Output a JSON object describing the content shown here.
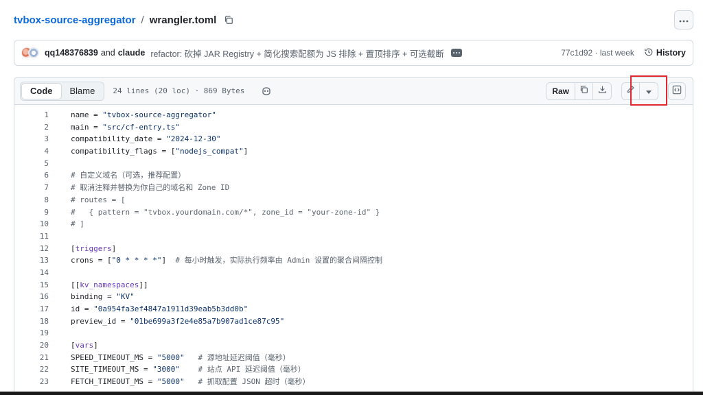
{
  "breadcrumb": {
    "repo": "tvbox-source-aggregator",
    "separator": "/",
    "file": "wrangler.toml"
  },
  "commit": {
    "user1": "qq148376839",
    "and": "and",
    "user2": "claude",
    "message": "refactor: 砍掉 JAR Registry + 简化搜索配额为 JS 排除 + 置顶排序 + 可选截断",
    "hash_time": "77c1d92 · last week",
    "history_label": "History"
  },
  "file_header": {
    "tab_code": "Code",
    "tab_blame": "Blame",
    "info": "24 lines (20 loc) · 869 Bytes",
    "raw_label": "Raw"
  },
  "icons": [
    "copy-icon",
    "kebab-icon",
    "copilot-icon",
    "download-icon",
    "pencil-icon",
    "triangle-down-icon",
    "code-square-icon",
    "history-icon"
  ],
  "colors": {
    "link": "#0969da",
    "highlight": "#e0282e",
    "string": "#0a3069",
    "section": "#6639ba"
  },
  "code_lines": [
    {
      "n": "1",
      "t": [
        [
          "k",
          "name = "
        ],
        [
          "s",
          "\"tvbox-source-aggregator\""
        ]
      ]
    },
    {
      "n": "2",
      "t": [
        [
          "k",
          "main = "
        ],
        [
          "s",
          "\"src/cf-entry.ts\""
        ]
      ]
    },
    {
      "n": "3",
      "t": [
        [
          "k",
          "compatibility_date = "
        ],
        [
          "s",
          "\"2024-12-30\""
        ]
      ]
    },
    {
      "n": "4",
      "t": [
        [
          "k",
          "compatibility_flags = ["
        ],
        [
          "s",
          "\"nodejs_compat\""
        ],
        [
          "k",
          "]"
        ]
      ]
    },
    {
      "n": "5",
      "t": []
    },
    {
      "n": "6",
      "t": [
        [
          "c",
          "# 自定义域名（可选，推荐配置）"
        ]
      ]
    },
    {
      "n": "7",
      "t": [
        [
          "c",
          "# 取消注释并替换为你自己的域名和 Zone ID"
        ]
      ]
    },
    {
      "n": "8",
      "t": [
        [
          "c",
          "# routes = ["
        ]
      ]
    },
    {
      "n": "9",
      "t": [
        [
          "c",
          "#   { pattern = \"tvbox.yourdomain.com/*\", zone_id = \"your-zone-id\" }"
        ]
      ]
    },
    {
      "n": "10",
      "t": [
        [
          "c",
          "# ]"
        ]
      ]
    },
    {
      "n": "11",
      "t": []
    },
    {
      "n": "12",
      "t": [
        [
          "k",
          "["
        ],
        [
          "x",
          "triggers"
        ],
        [
          "k",
          "]"
        ]
      ]
    },
    {
      "n": "13",
      "t": [
        [
          "k",
          "crons = ["
        ],
        [
          "s",
          "\"0 * * * *\""
        ],
        [
          "k",
          "]  "
        ],
        [
          "c",
          "# 每小时触发，实际执行频率由 Admin 设置的聚合间隔控制"
        ]
      ]
    },
    {
      "n": "14",
      "t": []
    },
    {
      "n": "15",
      "t": [
        [
          "k",
          "[["
        ],
        [
          "x",
          "kv_namespaces"
        ],
        [
          "k",
          "]]"
        ]
      ]
    },
    {
      "n": "16",
      "t": [
        [
          "k",
          "binding = "
        ],
        [
          "s",
          "\"KV\""
        ]
      ]
    },
    {
      "n": "17",
      "t": [
        [
          "k",
          "id = "
        ],
        [
          "s",
          "\"0a954fa3ef4847a1911d39eab5b3dd0b\""
        ]
      ]
    },
    {
      "n": "18",
      "t": [
        [
          "k",
          "preview_id = "
        ],
        [
          "s",
          "\"01be699a3f2e4e85a7b907ad1ce87c95\""
        ]
      ]
    },
    {
      "n": "19",
      "t": []
    },
    {
      "n": "20",
      "t": [
        [
          "k",
          "["
        ],
        [
          "x",
          "vars"
        ],
        [
          "k",
          "]"
        ]
      ]
    },
    {
      "n": "21",
      "t": [
        [
          "k",
          "SPEED_TIMEOUT_MS = "
        ],
        [
          "s",
          "\"5000\""
        ],
        [
          "k",
          "   "
        ],
        [
          "c",
          "# 源地址延迟阈值（毫秒）"
        ]
      ]
    },
    {
      "n": "22",
      "t": [
        [
          "k",
          "SITE_TIMEOUT_MS = "
        ],
        [
          "s",
          "\"3000\""
        ],
        [
          "k",
          "    "
        ],
        [
          "c",
          "# 站点 API 延迟阈值（毫秒）"
        ]
      ]
    },
    {
      "n": "23",
      "t": [
        [
          "k",
          "FETCH_TIMEOUT_MS = "
        ],
        [
          "s",
          "\"5000\""
        ],
        [
          "k",
          "   "
        ],
        [
          "c",
          "# 抓取配置 JSON 超时（毫秒）"
        ]
      ]
    }
  ]
}
